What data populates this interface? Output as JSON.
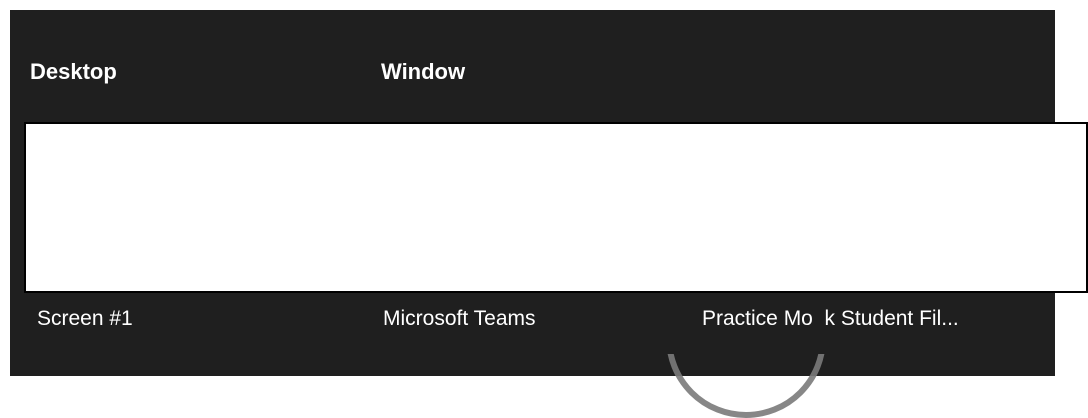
{
  "headers": {
    "desktop": "Desktop",
    "window": "Window"
  },
  "rows": [
    {
      "desktop": "Screen #1",
      "window": "Microsoft Teams",
      "title": "Practice Mo  k Student Fil..."
    }
  ],
  "colors": {
    "panel_background": "#1f1f1f",
    "text": "#ffffff",
    "preview_background": "#ffffff",
    "spinner": "#7a7a7a"
  },
  "icons": {
    "spinner": "loading-spinner-icon"
  }
}
